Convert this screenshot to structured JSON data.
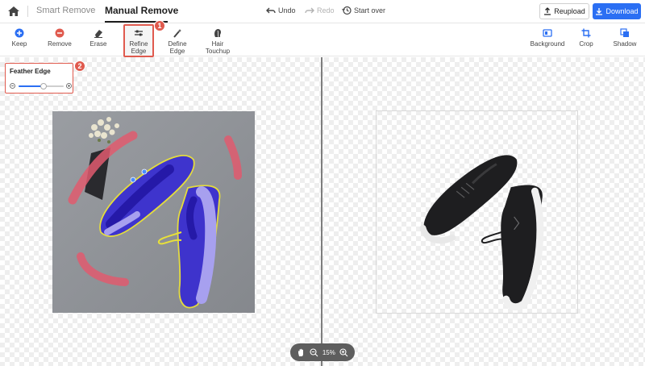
{
  "header": {
    "tabs": [
      {
        "label": "Smart Remove",
        "active": false
      },
      {
        "label": "Manual Remove",
        "active": true
      }
    ],
    "history": {
      "undo": "Undo",
      "redo": "Redo",
      "start_over": "Start over"
    },
    "reupload_label": "Reupload",
    "download_label": "Download"
  },
  "toolbar": {
    "left_tools": [
      {
        "label": "Keep",
        "icon": "plus-circle-icon"
      },
      {
        "label": "Remove",
        "icon": "minus-circle-icon"
      },
      {
        "label": "Erase",
        "icon": "eraser-icon"
      },
      {
        "label": "Refine Edge",
        "icon": "sliders-icon",
        "selected": true
      },
      {
        "label": "Define Edge",
        "icon": "magic-brush-icon"
      },
      {
        "label": "Hair Touchup",
        "icon": "hair-icon"
      }
    ],
    "right_tools": [
      {
        "label": "Background",
        "icon": "background-icon"
      },
      {
        "label": "Crop",
        "icon": "crop-icon"
      },
      {
        "label": "Shadow",
        "icon": "shadow-icon"
      }
    ]
  },
  "badges": {
    "refine": "1",
    "feather": "2"
  },
  "feather_panel": {
    "label": "Feather Edge",
    "value_fraction": 0.55
  },
  "zoom": {
    "level": "15%"
  },
  "colors": {
    "accent": "#2b6ff3",
    "highlight": "#e05a4e",
    "keep_mask": "#2b23c8",
    "remove_mask": "#e05a6e",
    "outline": "#e8e03a"
  }
}
